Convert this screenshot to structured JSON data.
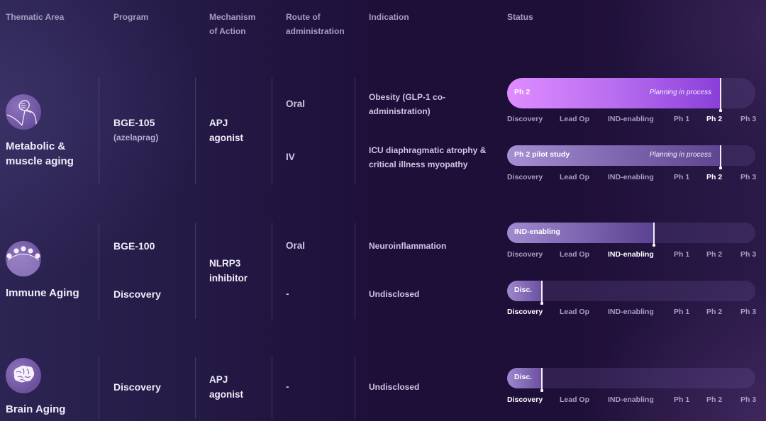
{
  "header": {
    "thematic_area": "Thematic Area",
    "program": "Program",
    "mechanism_l1": "Mechanism",
    "mechanism_l2": "of Action",
    "route_l1": "Route of",
    "route_l2": "administration",
    "indication": "Indication",
    "status": "Status"
  },
  "stages": [
    "Discovery",
    "Lead Op",
    "IND-enabling",
    "Ph 1",
    "Ph 2",
    "Ph 3"
  ],
  "colors": {
    "background_dark": "#1d0f38",
    "accent_bright": "#e08cff",
    "accent_deep": "#8a3fd9",
    "muted_fill": "#9a86c8",
    "text_primary": "#f1ecf8",
    "text_muted": "#a89dc2"
  },
  "areas": [
    {
      "name_l1": "Metabolic &",
      "name_l2": "muscle aging",
      "icon": "flexed-arm-icon",
      "program": "BGE-105",
      "program_sub": "(azelaprag)",
      "mechanism_l1": "APJ",
      "mechanism_l2": "agonist",
      "routes": [
        {
          "route": "Oral",
          "indication_l1": "Obesity (GLP-1 co-",
          "indication_l2": "administration)",
          "status": {
            "label": "Ph 2",
            "note": "Planning in process",
            "stage_index": 4,
            "progress_pct": 86,
            "style": "bright"
          }
        },
        {
          "route": "IV",
          "indication_l1": "ICU diaphragmatic atrophy &",
          "indication_l2": "critical illness myopathy",
          "status": {
            "label": "Ph 2 pilot study",
            "note": "Planning in process",
            "stage_index": 4,
            "progress_pct": 86,
            "style": "muted"
          }
        }
      ]
    },
    {
      "name_l1": "Immune Aging",
      "name_l2": "",
      "icon": "immune-cells-icon",
      "programs": [
        "BGE-100",
        "Discovery"
      ],
      "mechanism_l1": "NLRP3",
      "mechanism_l2": "inhibitor",
      "routes": [
        {
          "route": "Oral",
          "indication_l1": "Neuroinflammation",
          "status": {
            "label": "IND-enabling",
            "note": "",
            "stage_index": 2,
            "progress_pct": 59,
            "style": "muted"
          }
        },
        {
          "route": "-",
          "indication_l1": "Undisclosed",
          "status": {
            "label": "Disc.",
            "note": "",
            "stage_index": 0,
            "progress_pct": 14,
            "style": "muted"
          }
        }
      ]
    },
    {
      "name_l1": "Brain Aging",
      "name_l2": "",
      "icon": "brain-icon",
      "program": "Discovery",
      "mechanism_l1": "APJ",
      "mechanism_l2": "agonist",
      "routes": [
        {
          "route": "-",
          "indication_l1": "Undisclosed",
          "status": {
            "label": "Disc.",
            "note": "",
            "stage_index": 0,
            "progress_pct": 14,
            "style": "muted"
          }
        }
      ]
    }
  ]
}
